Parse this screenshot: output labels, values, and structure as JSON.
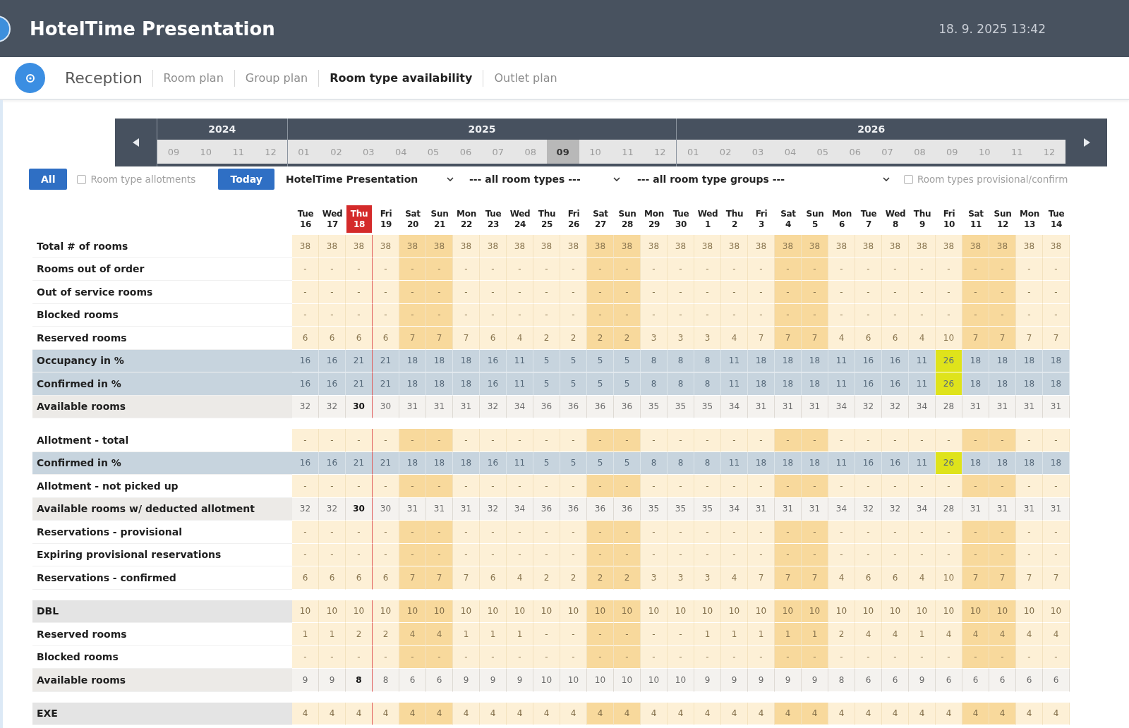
{
  "header": {
    "title": "HotelTime Presentation",
    "datetime": "18. 9. 2025 13:42"
  },
  "nav": {
    "module": "Reception",
    "items": [
      {
        "label": "Room plan",
        "selected": false
      },
      {
        "label": "Group plan",
        "selected": false
      },
      {
        "label": "Room type availability",
        "selected": true
      },
      {
        "label": "Outlet plan",
        "selected": false
      }
    ]
  },
  "timeline": {
    "years": [
      {
        "label": "2024",
        "months": [
          {
            "label": "09",
            "selected": false
          },
          {
            "label": "10",
            "selected": false
          },
          {
            "label": "11",
            "selected": false
          },
          {
            "label": "12",
            "selected": false
          }
        ]
      },
      {
        "label": "2025",
        "months": [
          {
            "label": "01",
            "selected": false
          },
          {
            "label": "02",
            "selected": false
          },
          {
            "label": "03",
            "selected": false
          },
          {
            "label": "04",
            "selected": false
          },
          {
            "label": "05",
            "selected": false
          },
          {
            "label": "06",
            "selected": false
          },
          {
            "label": "07",
            "selected": false
          },
          {
            "label": "08",
            "selected": false
          },
          {
            "label": "09",
            "selected": true
          },
          {
            "label": "10",
            "selected": false
          },
          {
            "label": "11",
            "selected": false
          },
          {
            "label": "12",
            "selected": false
          }
        ]
      },
      {
        "label": "2026",
        "months": [
          {
            "label": "01",
            "selected": false
          },
          {
            "label": "02",
            "selected": false
          },
          {
            "label": "03",
            "selected": false
          },
          {
            "label": "04",
            "selected": false
          },
          {
            "label": "05",
            "selected": false
          },
          {
            "label": "06",
            "selected": false
          },
          {
            "label": "07",
            "selected": false
          },
          {
            "label": "08",
            "selected": false
          },
          {
            "label": "09",
            "selected": false
          },
          {
            "label": "10",
            "selected": false
          },
          {
            "label": "11",
            "selected": false
          },
          {
            "label": "12",
            "selected": false
          }
        ]
      }
    ]
  },
  "filters": {
    "button": "All",
    "allotments": {
      "label": "Room type allotments",
      "checked": false
    },
    "today_button": "Today",
    "selects": [
      {
        "value": "HotelTime Presentation"
      },
      {
        "value": "--- all room types ---"
      },
      {
        "value": "--- all room type groups ---"
      }
    ],
    "provisional": {
      "label": "Room types provisional/confirm",
      "checked": false
    }
  },
  "table": {
    "columns": [
      {
        "day": "Tue",
        "date": "16",
        "weekend": false,
        "today": false
      },
      {
        "day": "Wed",
        "date": "17",
        "weekend": false,
        "today": false
      },
      {
        "day": "Thu",
        "date": "18",
        "weekend": false,
        "today": true
      },
      {
        "day": "Fri",
        "date": "19",
        "weekend": false,
        "today": false
      },
      {
        "day": "Sat",
        "date": "20",
        "weekend": true,
        "today": false
      },
      {
        "day": "Sun",
        "date": "21",
        "weekend": true,
        "today": false
      },
      {
        "day": "Mon",
        "date": "22",
        "weekend": false,
        "today": false
      },
      {
        "day": "Tue",
        "date": "23",
        "weekend": false,
        "today": false
      },
      {
        "day": "Wed",
        "date": "24",
        "weekend": false,
        "today": false
      },
      {
        "day": "Thu",
        "date": "25",
        "weekend": false,
        "today": false
      },
      {
        "day": "Fri",
        "date": "26",
        "weekend": false,
        "today": false
      },
      {
        "day": "Sat",
        "date": "27",
        "weekend": true,
        "today": false
      },
      {
        "day": "Sun",
        "date": "28",
        "weekend": true,
        "today": false
      },
      {
        "day": "Mon",
        "date": "29",
        "weekend": false,
        "today": false
      },
      {
        "day": "Tue",
        "date": "30",
        "weekend": false,
        "today": false
      },
      {
        "day": "Wed",
        "date": "1",
        "weekend": false,
        "today": false
      },
      {
        "day": "Thu",
        "date": "2",
        "weekend": false,
        "today": false
      },
      {
        "day": "Fri",
        "date": "3",
        "weekend": false,
        "today": false
      },
      {
        "day": "Sat",
        "date": "4",
        "weekend": true,
        "today": false
      },
      {
        "day": "Sun",
        "date": "5",
        "weekend": true,
        "today": false
      },
      {
        "day": "Mon",
        "date": "6",
        "weekend": false,
        "today": false
      },
      {
        "day": "Tue",
        "date": "7",
        "weekend": false,
        "today": false
      },
      {
        "day": "Wed",
        "date": "8",
        "weekend": false,
        "today": false
      },
      {
        "day": "Thu",
        "date": "9",
        "weekend": false,
        "today": false
      },
      {
        "day": "Fri",
        "date": "10",
        "weekend": false,
        "today": false
      },
      {
        "day": "Sat",
        "date": "11",
        "weekend": true,
        "today": false
      },
      {
        "day": "Sun",
        "date": "12",
        "weekend": true,
        "today": false
      },
      {
        "day": "Mon",
        "date": "13",
        "weekend": false,
        "today": false
      },
      {
        "day": "Tue",
        "date": "14",
        "weekend": false,
        "today": false
      }
    ],
    "sections": [
      {
        "rows": [
          {
            "label": "Total # of rooms",
            "kind": "plain",
            "values": [
              "38",
              "38",
              "38",
              "38",
              "38",
              "38",
              "38",
              "38",
              "38",
              "38",
              "38",
              "38",
              "38",
              "38",
              "38",
              "38",
              "38",
              "38",
              "38",
              "38",
              "38",
              "38",
              "38",
              "38",
              "38",
              "38",
              "38",
              "38",
              "38"
            ]
          },
          {
            "label": "Rooms out of order",
            "kind": "plain",
            "values": [
              "-",
              "-",
              "-",
              "-",
              "-",
              "-",
              "-",
              "-",
              "-",
              "-",
              "-",
              "-",
              "-",
              "-",
              "-",
              "-",
              "-",
              "-",
              "-",
              "-",
              "-",
              "-",
              "-",
              "-",
              "-",
              "-",
              "-",
              "-",
              "-"
            ]
          },
          {
            "label": "Out of service rooms",
            "kind": "plain",
            "values": [
              "-",
              "-",
              "-",
              "-",
              "-",
              "-",
              "-",
              "-",
              "-",
              "-",
              "-",
              "-",
              "-",
              "-",
              "-",
              "-",
              "-",
              "-",
              "-",
              "-",
              "-",
              "-",
              "-",
              "-",
              "-",
              "-",
              "-",
              "-",
              "-"
            ]
          },
          {
            "label": "Blocked rooms",
            "kind": "plain",
            "values": [
              "-",
              "-",
              "-",
              "-",
              "-",
              "-",
              "-",
              "-",
              "-",
              "-",
              "-",
              "-",
              "-",
              "-",
              "-",
              "-",
              "-",
              "-",
              "-",
              "-",
              "-",
              "-",
              "-",
              "-",
              "-",
              "-",
              "-",
              "-",
              "-"
            ]
          },
          {
            "label": "Reserved rooms",
            "kind": "plain",
            "values": [
              "6",
              "6",
              "6",
              "6",
              "7",
              "7",
              "7",
              "6",
              "4",
              "2",
              "2",
              "2",
              "2",
              "3",
              "3",
              "3",
              "4",
              "7",
              "7",
              "7",
              "4",
              "6",
              "6",
              "4",
              "10",
              "7",
              "7",
              "7",
              "7"
            ]
          },
          {
            "label": "Occupancy in %",
            "kind": "percent",
            "values": [
              {
                "value": "16",
                "highlighted": false
              },
              {
                "value": "16",
                "highlighted": false
              },
              {
                "value": "21",
                "highlighted": false
              },
              {
                "value": "21",
                "highlighted": false
              },
              {
                "value": "18",
                "highlighted": false
              },
              {
                "value": "18",
                "highlighted": false
              },
              {
                "value": "18",
                "highlighted": false
              },
              {
                "value": "16",
                "highlighted": false
              },
              {
                "value": "11",
                "highlighted": false
              },
              {
                "value": "5",
                "highlighted": false
              },
              {
                "value": "5",
                "highlighted": false
              },
              {
                "value": "5",
                "highlighted": false
              },
              {
                "value": "5",
                "highlighted": false
              },
              {
                "value": "8",
                "highlighted": false
              },
              {
                "value": "8",
                "highlighted": false
              },
              {
                "value": "8",
                "highlighted": false
              },
              {
                "value": "11",
                "highlighted": false
              },
              {
                "value": "18",
                "highlighted": false
              },
              {
                "value": "18",
                "highlighted": false
              },
              {
                "value": "18",
                "highlighted": false
              },
              {
                "value": "11",
                "highlighted": false
              },
              {
                "value": "16",
                "highlighted": false
              },
              {
                "value": "16",
                "highlighted": false
              },
              {
                "value": "11",
                "highlighted": false
              },
              {
                "value": "26",
                "highlighted": true
              },
              {
                "value": "18",
                "highlighted": false
              },
              {
                "value": "18",
                "highlighted": false
              },
              {
                "value": "18",
                "highlighted": false
              },
              {
                "value": "18",
                "highlighted": false
              }
            ]
          },
          {
            "label": "Confirmed in %",
            "kind": "percent",
            "values": [
              {
                "value": "16",
                "highlighted": false
              },
              {
                "value": "16",
                "highlighted": false
              },
              {
                "value": "21",
                "highlighted": false
              },
              {
                "value": "21",
                "highlighted": false
              },
              {
                "value": "18",
                "highlighted": false
              },
              {
                "value": "18",
                "highlighted": false
              },
              {
                "value": "18",
                "highlighted": false
              },
              {
                "value": "16",
                "highlighted": false
              },
              {
                "value": "11",
                "highlighted": false
              },
              {
                "value": "5",
                "highlighted": false
              },
              {
                "value": "5",
                "highlighted": false
              },
              {
                "value": "5",
                "highlighted": false
              },
              {
                "value": "5",
                "highlighted": false
              },
              {
                "value": "8",
                "highlighted": false
              },
              {
                "value": "8",
                "highlighted": false
              },
              {
                "value": "8",
                "highlighted": false
              },
              {
                "value": "11",
                "highlighted": false
              },
              {
                "value": "18",
                "highlighted": false
              },
              {
                "value": "18",
                "highlighted": false
              },
              {
                "value": "18",
                "highlighted": false
              },
              {
                "value": "11",
                "highlighted": false
              },
              {
                "value": "16",
                "highlighted": false
              },
              {
                "value": "16",
                "highlighted": false
              },
              {
                "value": "11",
                "highlighted": false
              },
              {
                "value": "26",
                "highlighted": true
              },
              {
                "value": "18",
                "highlighted": false
              },
              {
                "value": "18",
                "highlighted": false
              },
              {
                "value": "18",
                "highlighted": false
              },
              {
                "value": "18",
                "highlighted": false
              }
            ]
          },
          {
            "label": "Available rooms",
            "kind": "available",
            "values": [
              "32",
              "32",
              "30",
              "30",
              "31",
              "31",
              "31",
              "32",
              "34",
              "36",
              "36",
              "36",
              "36",
              "35",
              "35",
              "35",
              "34",
              "31",
              "31",
              "31",
              "34",
              "32",
              "32",
              "34",
              "28",
              "31",
              "31",
              "31",
              "31"
            ]
          }
        ]
      },
      {
        "rows": [
          {
            "label": "Allotment - total",
            "kind": "plain",
            "values": [
              "-",
              "-",
              "-",
              "-",
              "-",
              "-",
              "-",
              "-",
              "-",
              "-",
              "-",
              "-",
              "-",
              "-",
              "-",
              "-",
              "-",
              "-",
              "-",
              "-",
              "-",
              "-",
              "-",
              "-",
              "-",
              "-",
              "-",
              "-",
              "-"
            ]
          },
          {
            "label": "Confirmed in %",
            "kind": "percent",
            "values": [
              {
                "value": "16",
                "highlighted": false
              },
              {
                "value": "16",
                "highlighted": false
              },
              {
                "value": "21",
                "highlighted": false
              },
              {
                "value": "21",
                "highlighted": false
              },
              {
                "value": "18",
                "highlighted": false
              },
              {
                "value": "18",
                "highlighted": false
              },
              {
                "value": "18",
                "highlighted": false
              },
              {
                "value": "16",
                "highlighted": false
              },
              {
                "value": "11",
                "highlighted": false
              },
              {
                "value": "5",
                "highlighted": false
              },
              {
                "value": "5",
                "highlighted": false
              },
              {
                "value": "5",
                "highlighted": false
              },
              {
                "value": "5",
                "highlighted": false
              },
              {
                "value": "8",
                "highlighted": false
              },
              {
                "value": "8",
                "highlighted": false
              },
              {
                "value": "8",
                "highlighted": false
              },
              {
                "value": "11",
                "highlighted": false
              },
              {
                "value": "18",
                "highlighted": false
              },
              {
                "value": "18",
                "highlighted": false
              },
              {
                "value": "18",
                "highlighted": false
              },
              {
                "value": "11",
                "highlighted": false
              },
              {
                "value": "16",
                "highlighted": false
              },
              {
                "value": "16",
                "highlighted": false
              },
              {
                "value": "11",
                "highlighted": false
              },
              {
                "value": "26",
                "highlighted": true
              },
              {
                "value": "18",
                "highlighted": false
              },
              {
                "value": "18",
                "highlighted": false
              },
              {
                "value": "18",
                "highlighted": false
              },
              {
                "value": "18",
                "highlighted": false
              }
            ]
          },
          {
            "label": "Allotment - not picked up",
            "kind": "plain",
            "values": [
              "-",
              "-",
              "-",
              "-",
              "-",
              "-",
              "-",
              "-",
              "-",
              "-",
              "-",
              "-",
              "-",
              "-",
              "-",
              "-",
              "-",
              "-",
              "-",
              "-",
              "-",
              "-",
              "-",
              "-",
              "-",
              "-",
              "-",
              "-",
              "-"
            ]
          },
          {
            "label": "Available rooms w/ deducted allotment",
            "kind": "available",
            "values": [
              "32",
              "32",
              "30",
              "30",
              "31",
              "31",
              "31",
              "32",
              "34",
              "36",
              "36",
              "36",
              "36",
              "35",
              "35",
              "35",
              "34",
              "31",
              "31",
              "31",
              "34",
              "32",
              "32",
              "34",
              "28",
              "31",
              "31",
              "31",
              "31"
            ]
          },
          {
            "label": "Reservations - provisional",
            "kind": "plain",
            "values": [
              "-",
              "-",
              "-",
              "-",
              "-",
              "-",
              "-",
              "-",
              "-",
              "-",
              "-",
              "-",
              "-",
              "-",
              "-",
              "-",
              "-",
              "-",
              "-",
              "-",
              "-",
              "-",
              "-",
              "-",
              "-",
              "-",
              "-",
              "-",
              "-"
            ]
          },
          {
            "label": "Expiring provisional reservations",
            "kind": "plain",
            "values": [
              "-",
              "-",
              "-",
              "-",
              "-",
              "-",
              "-",
              "-",
              "-",
              "-",
              "-",
              "-",
              "-",
              "-",
              "-",
              "-",
              "-",
              "-",
              "-",
              "-",
              "-",
              "-",
              "-",
              "-",
              "-",
              "-",
              "-",
              "-",
              "-"
            ]
          },
          {
            "label": "Reservations - confirmed",
            "kind": "plain",
            "values": [
              "6",
              "6",
              "6",
              "6",
              "7",
              "7",
              "7",
              "6",
              "4",
              "2",
              "2",
              "2",
              "2",
              "3",
              "3",
              "3",
              "4",
              "7",
              "7",
              "7",
              "4",
              "6",
              "6",
              "4",
              "10",
              "7",
              "7",
              "7",
              "7"
            ]
          }
        ]
      },
      {
        "rows": [
          {
            "label": "DBL",
            "kind": "group",
            "values": [
              "10",
              "10",
              "10",
              "10",
              "10",
              "10",
              "10",
              "10",
              "10",
              "10",
              "10",
              "10",
              "10",
              "10",
              "10",
              "10",
              "10",
              "10",
              "10",
              "10",
              "10",
              "10",
              "10",
              "10",
              "10",
              "10",
              "10",
              "10",
              "10"
            ]
          },
          {
            "label": "Reserved rooms",
            "kind": "plain",
            "values": [
              "1",
              "1",
              "2",
              "2",
              "4",
              "4",
              "1",
              "1",
              "1",
              "-",
              "-",
              "-",
              "-",
              "-",
              "-",
              "1",
              "1",
              "1",
              "1",
              "1",
              "2",
              "4",
              "4",
              "1",
              "4",
              "4",
              "4",
              "4",
              "4"
            ]
          },
          {
            "label": "Blocked rooms",
            "kind": "plain",
            "values": [
              "-",
              "-",
              "-",
              "-",
              "-",
              "-",
              "-",
              "-",
              "-",
              "-",
              "-",
              "-",
              "-",
              "-",
              "-",
              "-",
              "-",
              "-",
              "-",
              "-",
              "-",
              "-",
              "-",
              "-",
              "-",
              "-",
              "-",
              "-",
              "-"
            ]
          },
          {
            "label": "Available rooms",
            "kind": "available",
            "values": [
              "9",
              "9",
              "8",
              "8",
              "6",
              "6",
              "9",
              "9",
              "9",
              "10",
              "10",
              "10",
              "10",
              "10",
              "10",
              "9",
              "9",
              "9",
              "9",
              "9",
              "8",
              "6",
              "6",
              "9",
              "6",
              "6",
              "6",
              "6",
              "6"
            ]
          }
        ]
      },
      {
        "rows": [
          {
            "label": "EXE",
            "kind": "group",
            "values": [
              "4",
              "4",
              "4",
              "4",
              "4",
              "4",
              "4",
              "4",
              "4",
              "4",
              "4",
              "4",
              "4",
              "4",
              "4",
              "4",
              "4",
              "4",
              "4",
              "4",
              "4",
              "4",
              "4",
              "4",
              "4",
              "4",
              "4",
              "4",
              "4"
            ]
          }
        ]
      }
    ]
  }
}
